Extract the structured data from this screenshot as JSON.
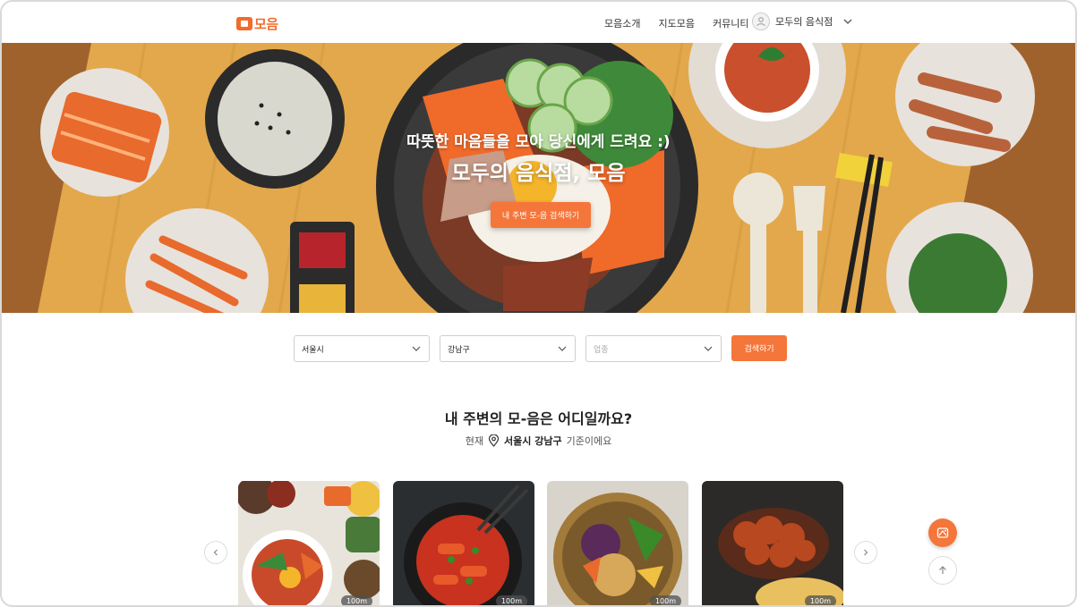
{
  "header": {
    "logo_text": "모음",
    "nav": [
      "모음소개",
      "지도모음",
      "커뮤니티"
    ],
    "user_name": "모두의 음식점"
  },
  "hero": {
    "subtitle": "따뜻한 마음들을 모아 당신에게 드려요 :)",
    "title": "모두의 음식점, 모음",
    "cta": "내 주변 모-음 검색하기"
  },
  "search": {
    "city": "서울시",
    "district": "강남구",
    "category_placeholder": "업종",
    "button": "검색하기"
  },
  "nearby": {
    "title": "내 주변의 모-음은 어디일까요?",
    "prefix": "현재",
    "location": "서울시 강남구",
    "suffix": "기준이에요"
  },
  "cards": [
    {
      "distance": "100m"
    },
    {
      "distance": "100m"
    },
    {
      "distance": "100m"
    },
    {
      "distance": "100m"
    }
  ],
  "colors": {
    "accent": "#f5763a",
    "brand": "#f26b2b"
  }
}
